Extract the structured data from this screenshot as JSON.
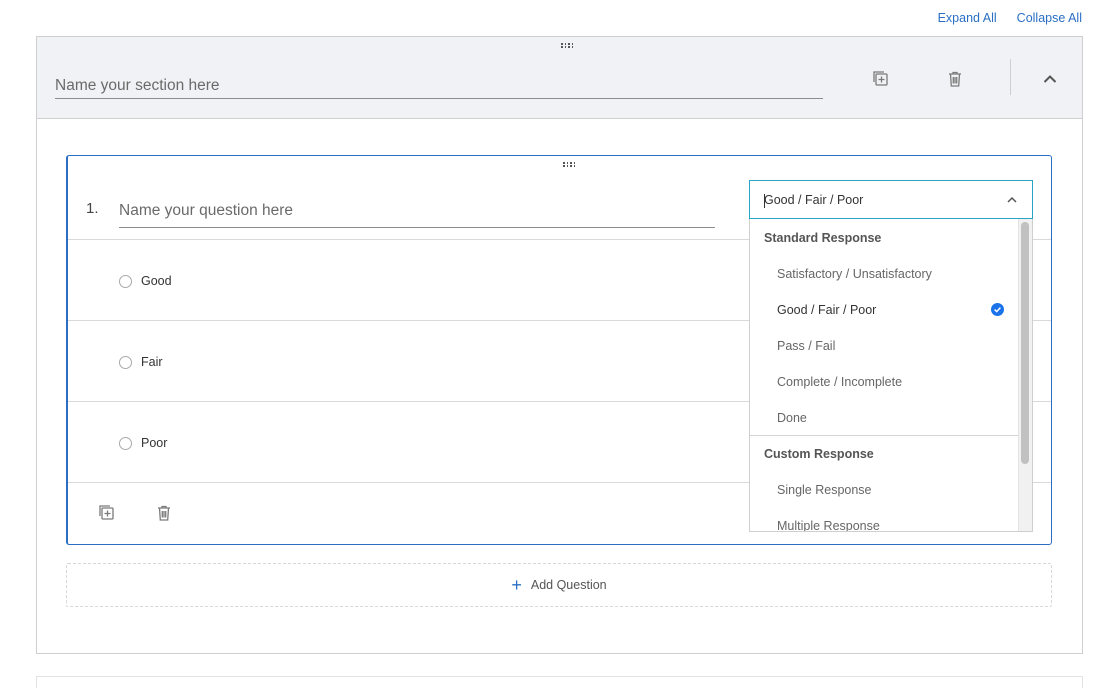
{
  "top_links": {
    "expand_all": "Expand All",
    "collapse_all": "Collapse All"
  },
  "section": {
    "name_placeholder": "Name your section here",
    "icons": {
      "duplicate": "duplicate-icon",
      "delete": "trash-icon",
      "collapse": "chevron-up-icon",
      "drag": "drag-handle-icon"
    }
  },
  "question": {
    "number": "1.",
    "name_placeholder": "Name your question here",
    "options": [
      "Good",
      "Fair",
      "Poor"
    ],
    "icons": {
      "duplicate": "duplicate-icon",
      "delete": "trash-icon",
      "drag": "drag-handle-icon"
    }
  },
  "response_dropdown": {
    "selected_value": "Good / Fair / Poor",
    "groups": [
      {
        "label": "Standard Response",
        "items": [
          "Satisfactory / Unsatisfactory",
          "Good / Fair / Poor",
          "Pass / Fail",
          "Complete / Incomplete",
          "Done"
        ]
      },
      {
        "label": "Custom Response",
        "items": [
          "Single Response",
          "Multiple Response"
        ]
      }
    ],
    "check_color": "#1a73e8"
  },
  "add_question": {
    "label": "Add Question",
    "icon": "plus-icon",
    "icon_color": "#2a6fc4"
  },
  "colors": {
    "accent": "#2a6fc4",
    "field_focus": "#2aa4c4",
    "section_header_bg": "#f1f2f5"
  }
}
